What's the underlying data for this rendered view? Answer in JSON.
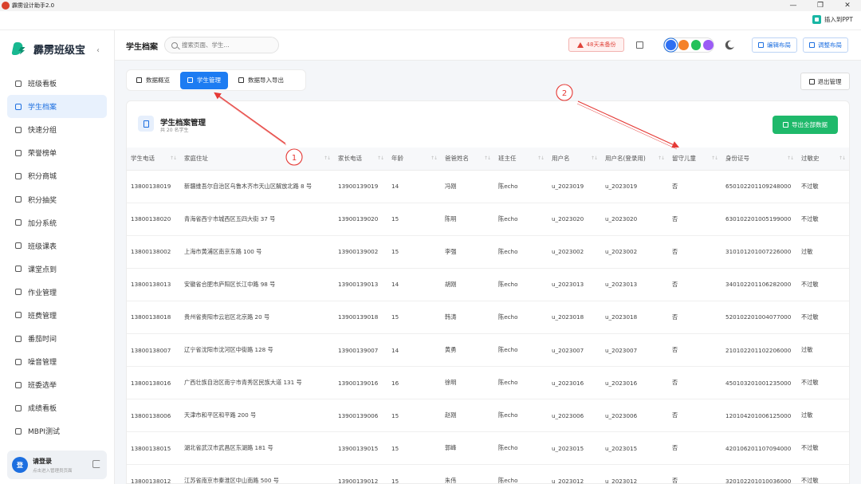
{
  "window": {
    "title": "霹雳设计助手2.0",
    "controls": [
      "—",
      "❐",
      "✕"
    ],
    "ppt_button": "插入到PPT"
  },
  "sidebar": {
    "brand": "霹雳班级宝",
    "collapse": "‹",
    "items": [
      {
        "label": "班级看板",
        "icon": "dashboard-icon"
      },
      {
        "label": "学生档案",
        "icon": "students-icon",
        "active": true
      },
      {
        "label": "快速分组",
        "icon": "group-icon"
      },
      {
        "label": "荣誉榜单",
        "icon": "trophy-icon"
      },
      {
        "label": "积分商城",
        "icon": "shop-icon"
      },
      {
        "label": "积分抽奖",
        "icon": "gift-icon"
      },
      {
        "label": "加分系统",
        "icon": "plus-icon"
      },
      {
        "label": "班级课表",
        "icon": "calendar-icon"
      },
      {
        "label": "课堂点到",
        "icon": "checkin-icon"
      },
      {
        "label": "作业管理",
        "icon": "homework-icon"
      },
      {
        "label": "班费管理",
        "icon": "wallet-icon"
      },
      {
        "label": "番茄时间",
        "icon": "timer-icon"
      },
      {
        "label": "噪音管理",
        "icon": "sound-icon"
      },
      {
        "label": "班委选举",
        "icon": "vote-icon"
      },
      {
        "label": "成绩看板",
        "icon": "grade-icon"
      },
      {
        "label": "MBPI测试",
        "icon": "test-icon"
      }
    ],
    "user": {
      "avatar": "登",
      "name": "请登录",
      "hint": "点击进入管理员页面"
    }
  },
  "header": {
    "title": "学生档案",
    "search_placeholder": "搜索页面、学生...",
    "backup_warning": "48天未备份",
    "theme_colors": [
      "#2e6ff2",
      "#f5822a",
      "#23c15a",
      "#9b5cf5"
    ],
    "edit_layout": "编辑布局",
    "adjust_layout": "调整布局"
  },
  "tabs": [
    {
      "label": "数据概览",
      "active": false
    },
    {
      "label": "学生管理",
      "active": true
    },
    {
      "label": "数据导入导出",
      "active": false
    }
  ],
  "exit_button": "退出管理",
  "panel": {
    "title": "学生档案管理",
    "subtitle": "共 20 名学生",
    "export_button": "导出全部数据"
  },
  "table": {
    "columns": [
      "学生电话",
      "家庭住址",
      "家长电话",
      "年龄",
      "爸爸姓名",
      "班主任",
      "用户名",
      "用户名(登录用)",
      "留守儿童",
      "身份证号",
      "过敏史"
    ],
    "rows": [
      [
        "13800138019",
        "新疆维吾尔自治区乌鲁木齐市天山区解放北路 8 号",
        "13900139019",
        "14",
        "冯刚",
        "陈echo",
        "u_2023019",
        "u_2023019",
        "否",
        "650102201109248000",
        "不过敏"
      ],
      [
        "13800138020",
        "青海省西宁市城西区五四大街 37 号",
        "13900139020",
        "15",
        "陈明",
        "陈echo",
        "u_2023020",
        "u_2023020",
        "否",
        "630102201005199000",
        "不过敏"
      ],
      [
        "13800138002",
        "上海市黄浦区南京东路 100 号",
        "13900139002",
        "15",
        "李强",
        "陈echo",
        "u_2023002",
        "u_2023002",
        "否",
        "310101201007226000",
        "过敏"
      ],
      [
        "13800138013",
        "安徽省合肥市庐阳区长江中路 98 号",
        "13900139013",
        "14",
        "胡刚",
        "陈echo",
        "u_2023013",
        "u_2023013",
        "否",
        "340102201106282000",
        "不过敏"
      ],
      [
        "13800138018",
        "贵州省贵阳市云岩区北京路 20 号",
        "13900139018",
        "15",
        "韩涛",
        "陈echo",
        "u_2023018",
        "u_2023018",
        "否",
        "520102201004077000",
        "不过敏"
      ],
      [
        "13800138007",
        "辽宁省沈阳市沈河区中街路 128 号",
        "13900139007",
        "14",
        "黄勇",
        "陈echo",
        "u_2023007",
        "u_2023007",
        "否",
        "210102201102206000",
        "过敏"
      ],
      [
        "13800138016",
        "广西壮族自治区南宁市青秀区民族大道 131 号",
        "13900139016",
        "16",
        "徐明",
        "陈echo",
        "u_2023016",
        "u_2023016",
        "否",
        "450103201001235000",
        "不过敏"
      ],
      [
        "13800138006",
        "天津市和平区和平路 200 号",
        "13900139006",
        "15",
        "赵刚",
        "陈echo",
        "u_2023006",
        "u_2023006",
        "否",
        "120104201006125000",
        "过敏"
      ],
      [
        "13800138015",
        "湖北省武汉市武昌区东湖路 181 号",
        "13900139015",
        "15",
        "郭峰",
        "陈echo",
        "u_2023015",
        "u_2023015",
        "否",
        "420106201107094000",
        "不过敏"
      ],
      [
        "13800138012",
        "江苏省南京市秦淮区中山南路 500 号",
        "13900139012",
        "15",
        "朱伟",
        "陈echo",
        "u_2023012",
        "u_2023012",
        "否",
        "320102201010036000",
        "不过敏"
      ]
    ]
  },
  "annotations": {
    "marker_1": "1",
    "marker_2": "2",
    "color": "#e53935"
  }
}
